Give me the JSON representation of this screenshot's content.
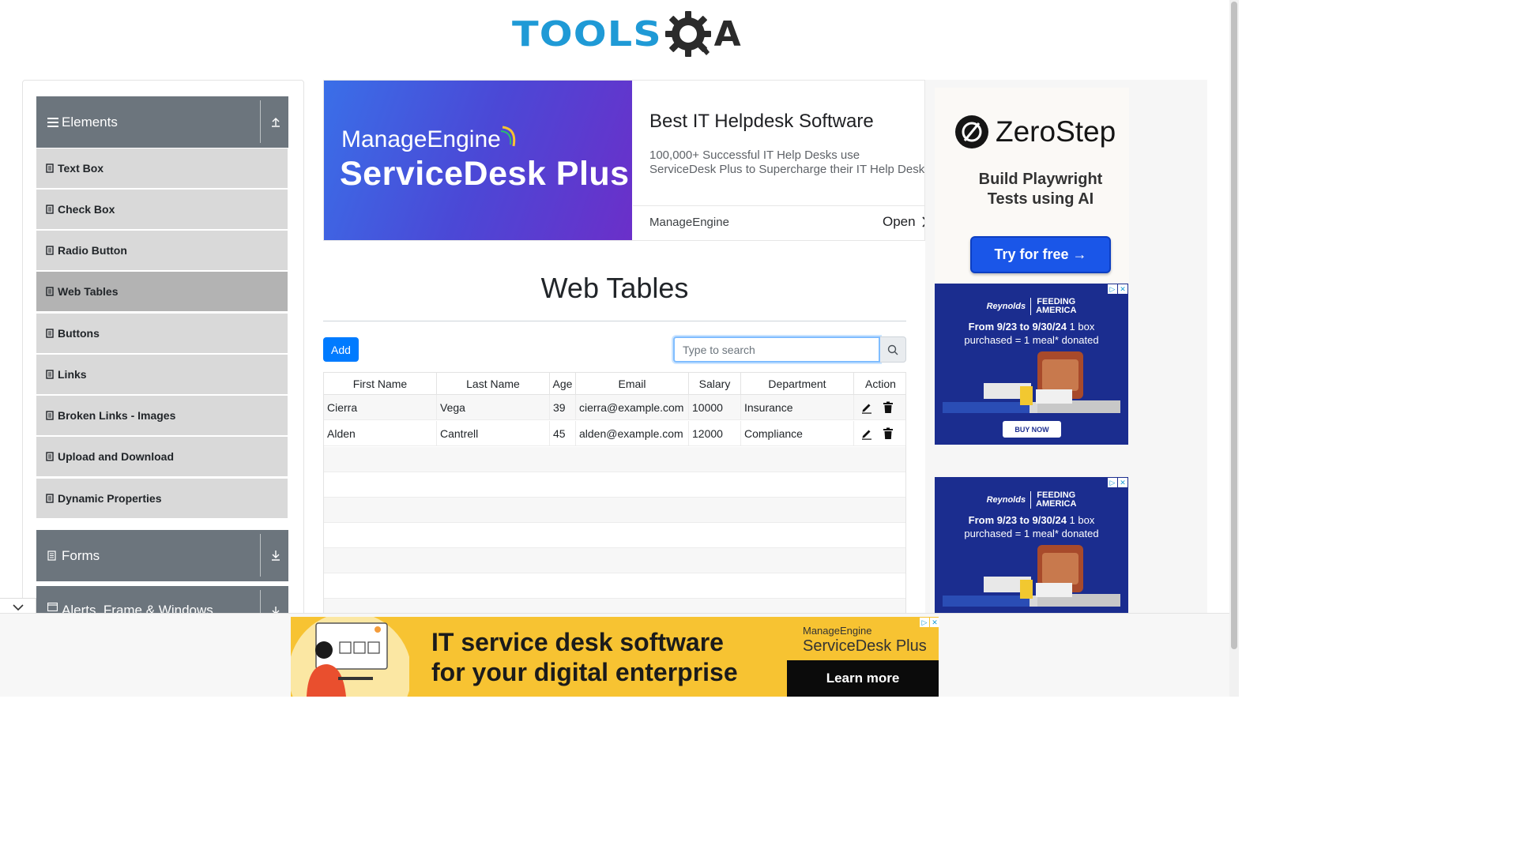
{
  "header": {
    "logo_left": "TOOLS",
    "logo_right": "A"
  },
  "sidebar": {
    "groups": [
      {
        "title": "Elements",
        "icon": "hamburger-icon",
        "toggle_icon": "collapse-up-icon"
      },
      {
        "title": "Forms",
        "icon": "form-icon",
        "toggle_icon": "expand-down-icon"
      },
      {
        "title": "Alerts, Frame & Windows",
        "icon": "window-icon",
        "toggle_icon": "expand-down-icon"
      }
    ],
    "items": [
      {
        "label": "Text Box"
      },
      {
        "label": "Check Box"
      },
      {
        "label": "Radio Button"
      },
      {
        "label": "Web Tables",
        "active": true
      },
      {
        "label": "Buttons"
      },
      {
        "label": "Links"
      },
      {
        "label": "Broken Links - Images"
      },
      {
        "label": "Upload and Download"
      },
      {
        "label": "Dynamic Properties"
      }
    ]
  },
  "top_ad": {
    "brand": "ManageEngine",
    "product": "ServiceDesk Plus",
    "title": "Best IT Helpdesk Software",
    "description": "100,000+ Successful IT Help Desks use ServiceDesk Plus to Supercharge their IT Help Desk",
    "advertiser": "ManageEngine",
    "open_label": "Open"
  },
  "main": {
    "title": "Web Tables",
    "add_label": "Add",
    "search": {
      "placeholder": "Type to search",
      "value": ""
    }
  },
  "table": {
    "columns": [
      "First Name",
      "Last Name",
      "Age",
      "Email",
      "Salary",
      "Department",
      "Action"
    ],
    "rows": [
      [
        "Cierra",
        "Vega",
        "39",
        "cierra@example.com",
        "10000",
        "Insurance"
      ],
      [
        "Alden",
        "Cantrell",
        "45",
        "alden@example.com",
        "12000",
        "Compliance"
      ]
    ]
  },
  "right_ad": {
    "brand": "ZeroStep",
    "tagline_1": "Build Playwright",
    "tagline_2": "Tests using AI",
    "cta": "Try for free →"
  },
  "reynolds_ad": {
    "logo": "Reynolds",
    "partner_1": "FEEDING",
    "partner_2": "AMERICA",
    "line_1_bold": "From 9/23 to 9/30/24",
    "line_1_rest": " 1 box",
    "line_2": "purchased = 1 meal* donated",
    "cta": "BUY NOW"
  },
  "bottom_ad": {
    "headline_1": "IT service desk software",
    "headline_2": "for your digital enterprise",
    "brand": "ManageEngine",
    "product": "ServiceDesk Plus",
    "cta": "Learn more"
  },
  "colors": {
    "sidebar_header": "#6c757d",
    "sidebar_item": "#d9d9d9",
    "sidebar_item_active": "#b3b3b3",
    "primary": "#007bff",
    "logo_blue": "#1f9ad6"
  }
}
